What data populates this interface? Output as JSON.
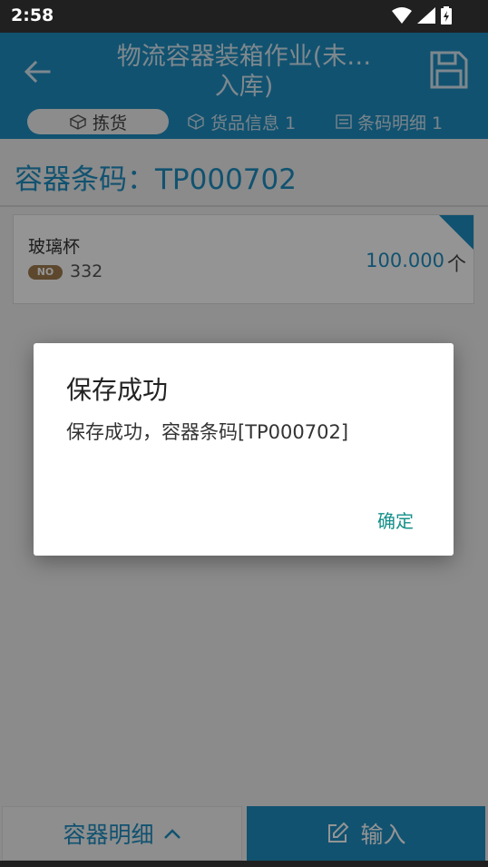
{
  "status_bar": {
    "time": "2:58",
    "icons": [
      "wifi-icon",
      "signal-icon",
      "battery-icon"
    ]
  },
  "app_bar": {
    "title": "物流容器装箱作业(未…\n入库)",
    "title_line1": "物流容器装箱作业(未…",
    "title_line2": "入库)",
    "back_icon": "arrow-left-icon",
    "save_icon": "floppy-disk-icon"
  },
  "tabs": [
    {
      "label": "拣货",
      "icon": "box-open-icon",
      "active": true
    },
    {
      "label": "货品信息 1",
      "icon": "cube-icon",
      "active": false
    },
    {
      "label": "条码明细 1",
      "icon": "list-icon",
      "active": false
    }
  ],
  "container": {
    "label": "容器条码：TP000702"
  },
  "item": {
    "name": "玻璃杯",
    "badge": "NO",
    "number": "332",
    "quantity": "100.000",
    "unit": "个"
  },
  "bottom_bar": {
    "detail_label": "容器明细",
    "input_label": "输入"
  },
  "dialog": {
    "title": "保存成功",
    "message": "保存成功，容器条码[TP000702]",
    "ok_label": "确定"
  },
  "colors": {
    "primary": "#1e8ec2",
    "badge": "#a07c50",
    "dialog_action": "#14908a"
  }
}
